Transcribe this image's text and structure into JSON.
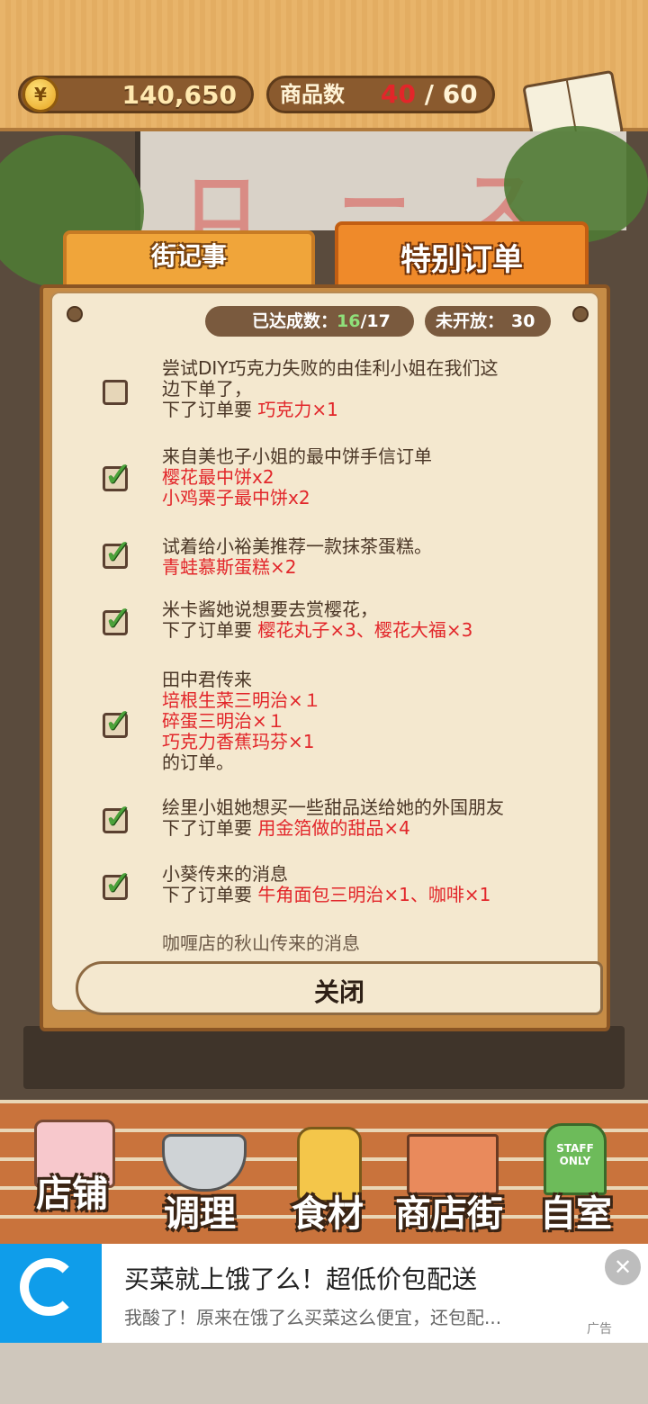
{
  "header": {
    "coins": "140,650",
    "coin_symbol": "¥",
    "goods_label": "商品数",
    "goods_current": "40",
    "goods_max": "/ 60",
    "recipe_label": "食谱"
  },
  "tabs": [
    {
      "label": "街记事",
      "active": false
    },
    {
      "label": "特别订单",
      "active": true
    }
  ],
  "stats": {
    "done_label": "已达成数：",
    "done_current": "16",
    "done_total": "/17",
    "unopened_label": "未开放：",
    "unopened_value": "30"
  },
  "orders": [
    {
      "done": false,
      "lines": [
        {
          "text": "尝试DIY巧克力失败的由佳利小姐在我们这",
          "red": false
        },
        {
          "text": "边下单了，",
          "red": false
        },
        {
          "text": "下了订单要 ",
          "red": false,
          "tail": "巧克力×1"
        }
      ]
    },
    {
      "done": true,
      "lines": [
        {
          "text": "来自美也子小姐的最中饼手信订单",
          "red": false
        },
        {
          "text": "樱花最中饼x2",
          "red": true
        },
        {
          "text": "小鸡栗子最中饼x2",
          "red": true
        }
      ]
    },
    {
      "done": true,
      "lines": [
        {
          "text": "试着给小裕美推荐一款抹茶蛋糕。",
          "red": false
        },
        {
          "text": "青蛙慕斯蛋糕×2",
          "red": true
        }
      ]
    },
    {
      "done": true,
      "lines": [
        {
          "text": "米卡酱她说想要去赏樱花，",
          "red": false
        },
        {
          "text": "下了订单要 ",
          "red": false,
          "tail": "樱花丸子×3、樱花大福×3"
        }
      ]
    },
    {
      "done": true,
      "lines": [
        {
          "text": "田中君传来",
          "red": false
        },
        {
          "text": "培根生菜三明治×１",
          "red": true
        },
        {
          "text": "碎蛋三明治×１",
          "red": true
        },
        {
          "text": "巧克力香蕉玛芬×1",
          "red": true
        },
        {
          "text": "的订单。",
          "red": false
        }
      ]
    },
    {
      "done": true,
      "lines": [
        {
          "text": "绘里小姐她想买一些甜品送给她的外国朋友",
          "red": false
        },
        {
          "text": "下了订单要 ",
          "red": false,
          "tail": "用金箔做的甜品×4"
        }
      ]
    },
    {
      "done": true,
      "lines": [
        {
          "text": "小葵传来的消息",
          "red": false
        },
        {
          "text": "下了订单要 ",
          "red": false,
          "tail": "牛角面包三明治×1、咖啡×1"
        }
      ]
    }
  ],
  "partial_next": "咖喱店的秋山传来的消息",
  "close_label": "关闭",
  "menu": [
    {
      "label": "店铺",
      "icon": "cake-icon"
    },
    {
      "label": "调理",
      "icon": "mixing-bowl-icon"
    },
    {
      "label": "食材",
      "icon": "flour-sack-icon"
    },
    {
      "label": "商店街",
      "icon": "shop-street-icon"
    },
    {
      "label": "自室",
      "icon": "staff-only-door-icon",
      "sign": "STAFF ONLY"
    }
  ],
  "ad": {
    "title": "买菜就上饿了么！超低价包配送",
    "subtitle": "我酸了！原来在饿了么买菜这么便宜，还包配...",
    "tag": "广告",
    "close": "✕"
  }
}
